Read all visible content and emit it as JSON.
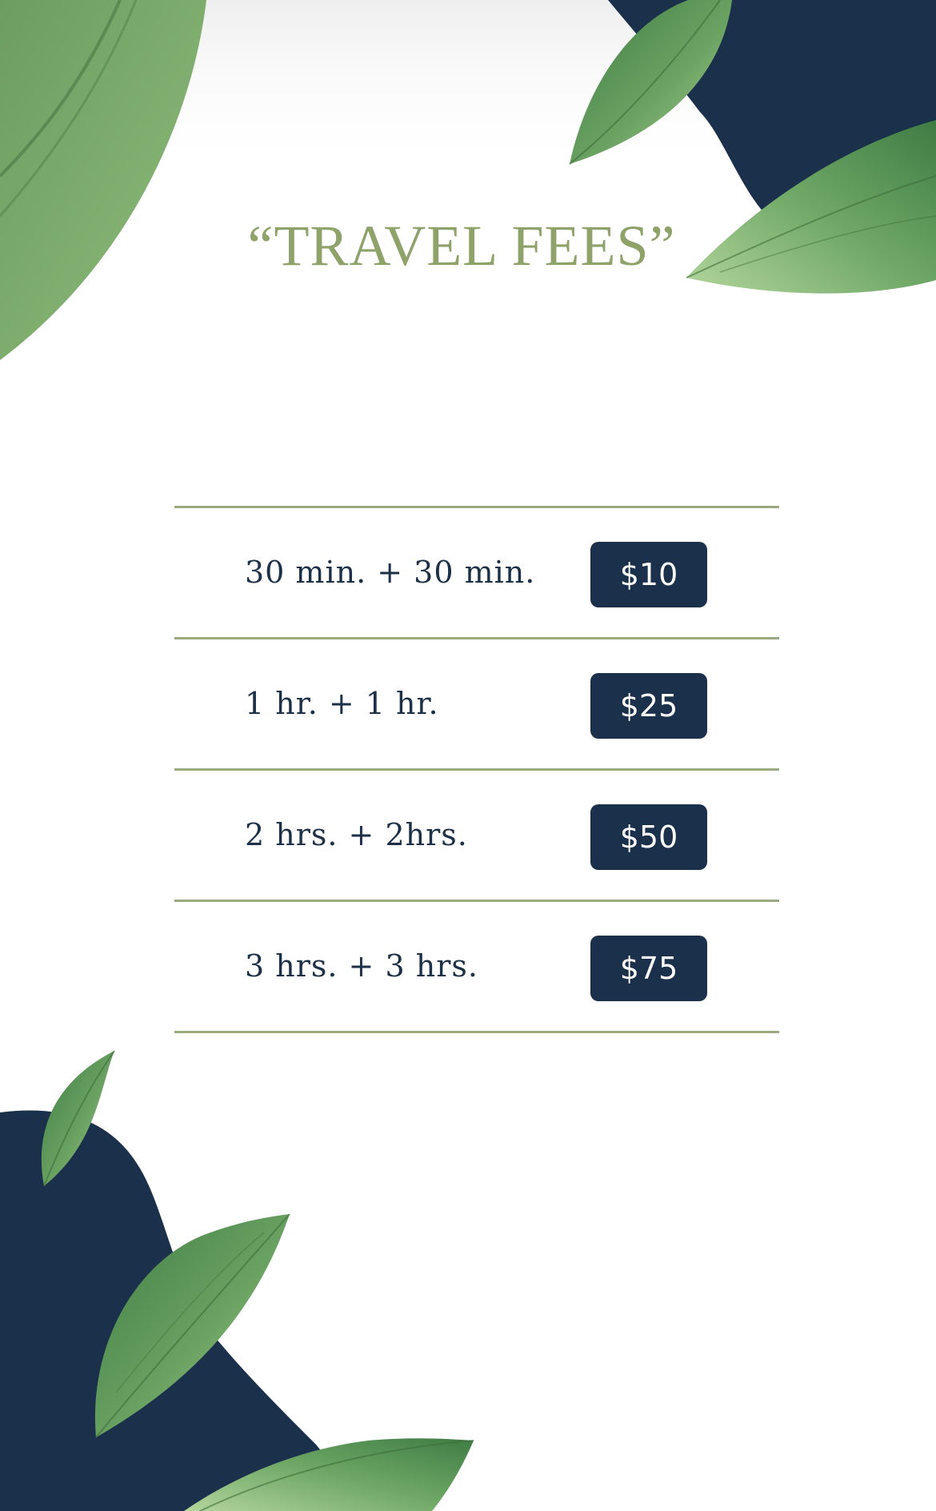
{
  "page": {
    "title": "“TRAVEL FEES”"
  },
  "fees": [
    {
      "label": "30 min. + 30 min.",
      "price": "$10"
    },
    {
      "label": "1 hr. + 1 hr.",
      "price": "$25"
    },
    {
      "label": "2 hrs. + 2hrs.",
      "price": "$50"
    },
    {
      "label": "3 hrs. + 3 hrs.",
      "price": "$75"
    }
  ],
  "colors": {
    "navy": "#1b304b",
    "sage_title": "#8fa26a",
    "divider": "#9bab7f",
    "leaf_dark": "#4f8a4d",
    "leaf_light": "#9cc58a"
  },
  "decorations": [
    "leaf-icon",
    "navy-blob"
  ]
}
